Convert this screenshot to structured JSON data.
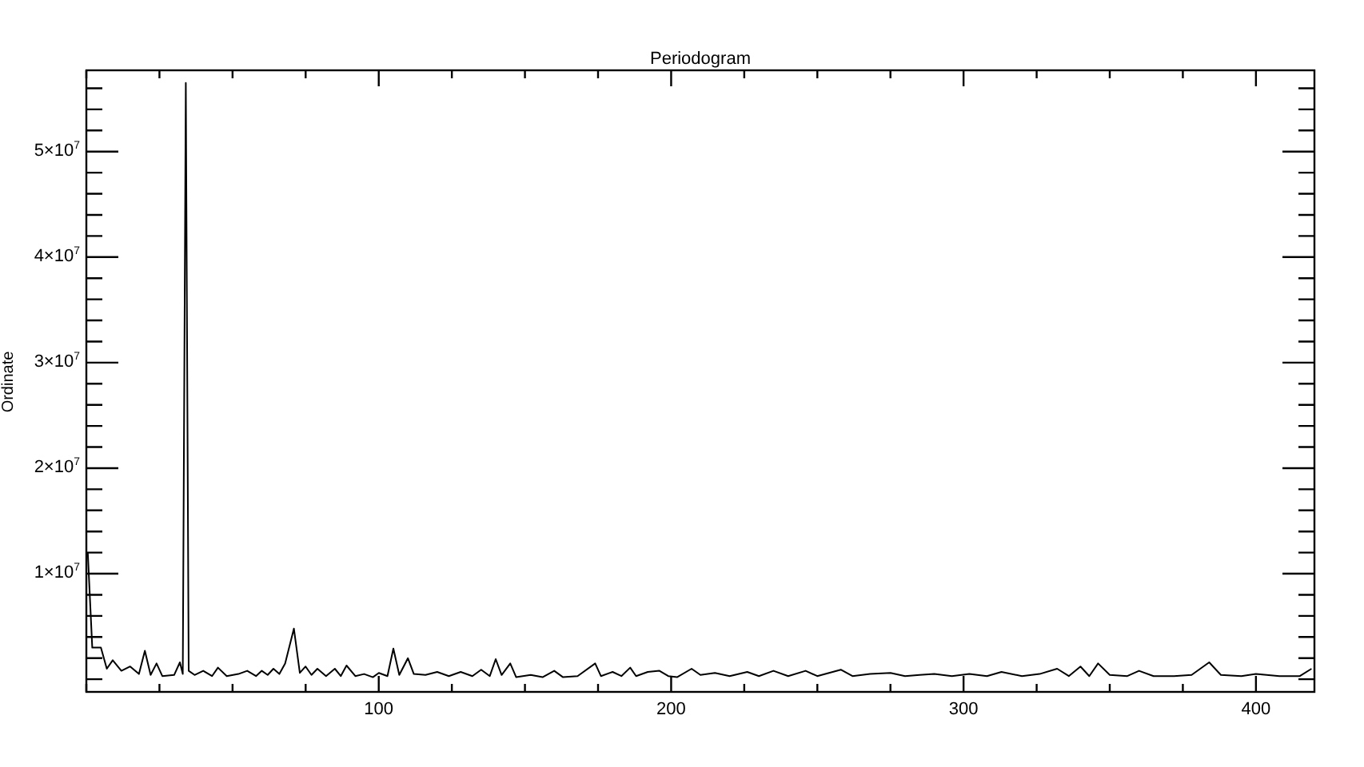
{
  "chart_data": {
    "type": "line",
    "title": "Periodogram",
    "ylabel": "Ordinate",
    "xlim": [
      0,
      420
    ],
    "ylim": [
      -1200000.0,
      57700000.0
    ],
    "xticks": [
      100,
      200,
      300,
      400
    ],
    "yticks": [
      {
        "value": 10000000.0,
        "label": "1×10$^{7}$"
      },
      {
        "value": 20000000.0,
        "label": "2×10$^{7}$"
      },
      {
        "value": 30000000.0,
        "label": "3×10$^{7}$"
      },
      {
        "value": 40000000.0,
        "label": "4×10$^{7}$"
      },
      {
        "value": 50000000.0,
        "label": "5×10$^{7}$"
      }
    ],
    "x": [
      0.5,
      2,
      5,
      7,
      9,
      12,
      15,
      18,
      20,
      22,
      24,
      26,
      30,
      32,
      33,
      34,
      35,
      37,
      40,
      43,
      45,
      48,
      52,
      55,
      58,
      60,
      62,
      64,
      66,
      68,
      71,
      73,
      75,
      77,
      79,
      82,
      85,
      87,
      89,
      92,
      95,
      98,
      100,
      103,
      105,
      107,
      110,
      112,
      116,
      120,
      124,
      128,
      132,
      135,
      138,
      140,
      142,
      145,
      147,
      152,
      156,
      160,
      163,
      168,
      174,
      176,
      180,
      183,
      186,
      188,
      192,
      196,
      199,
      202,
      207,
      210,
      215,
      220,
      226,
      230,
      235,
      240,
      246,
      250,
      258,
      262,
      268,
      275,
      280,
      285,
      290,
      296,
      302,
      308,
      313,
      320,
      326,
      332,
      336,
      340,
      343,
      346,
      350,
      356,
      360,
      365,
      372,
      378,
      384,
      388,
      395,
      400,
      408,
      415,
      419
    ],
    "series": [
      {
        "color": "#000000",
        "values": [
          12000000.0,
          3000000.0,
          3000000.0,
          1000000.0,
          1800000.0,
          800000.0,
          1200000.0,
          500000.0,
          2700000.0,
          400000.0,
          1500000.0,
          300000.0,
          400000.0,
          1600000.0,
          500000.0,
          56500000.0,
          800000.0,
          400000.0,
          800000.0,
          300000.0,
          1100000.0,
          300000.0,
          500000.0,
          800000.0,
          300000.0,
          800000.0,
          400000.0,
          1000000.0,
          500000.0,
          1500000.0,
          4800000.0,
          600000.0,
          1200000.0,
          400000.0,
          1000000.0,
          300000.0,
          1000000.0,
          300000.0,
          1300000.0,
          300000.0,
          500000.0,
          200000.0,
          600000.0,
          300000.0,
          2900000.0,
          400000.0,
          2000000.0,
          500000.0,
          400000.0,
          700000.0,
          300000.0,
          700000.0,
          300000.0,
          900000.0,
          300000.0,
          1900000.0,
          400000.0,
          1500000.0,
          200000.0,
          400000.0,
          200000.0,
          800000.0,
          200000.0,
          300000.0,
          1500000.0,
          300000.0,
          700000.0,
          300000.0,
          1100000.0,
          300000.0,
          700000.0,
          800000.0,
          300000.0,
          200000.0,
          1000000.0,
          400000.0,
          600000.0,
          300000.0,
          700000.0,
          300000.0,
          800000.0,
          300000.0,
          800000.0,
          300000.0,
          900000.0,
          300000.0,
          500000.0,
          600000.0,
          300000.0,
          400000.0,
          500000.0,
          300000.0,
          500000.0,
          300000.0,
          700000.0,
          300000.0,
          500000.0,
          1000000.0,
          300000.0,
          1200000.0,
          300000.0,
          1500000.0,
          400000.0,
          300000.0,
          800000.0,
          300000.0,
          300000.0,
          400000.0,
          1600000.0,
          400000.0,
          300000.0,
          500000.0,
          300000.0,
          300000.0,
          1000000.0
        ]
      }
    ]
  }
}
